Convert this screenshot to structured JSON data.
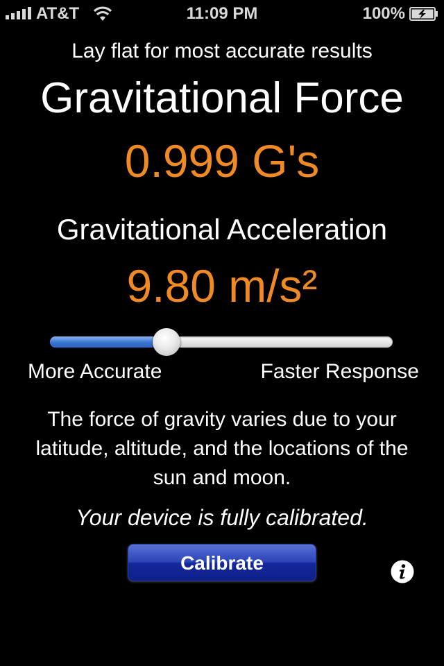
{
  "status_bar": {
    "carrier": "AT&T",
    "time": "11:09 PM",
    "battery": "100%",
    "icons": [
      "signal-bars-icon",
      "wifi-icon",
      "battery-charging-icon"
    ]
  },
  "hint": "Lay flat for most accurate results",
  "force": {
    "title": "Gravitational Force",
    "value": "0.999 G's"
  },
  "acceleration": {
    "title": "Gravitational Acceleration",
    "value": "9.80 m/s²"
  },
  "slider": {
    "position": 0.34,
    "left_label": "More Accurate",
    "right_label": "Faster Response"
  },
  "info_text": "The force of gravity varies due to your latitude, altitude, and the locations of the sun and moon.",
  "calibration_status": "Your device is fully calibrated.",
  "calibrate_button": "Calibrate",
  "info_button_icon": "info-icon",
  "colors": {
    "accent": "#f08a24",
    "background": "#000000",
    "button": "#1e34a8",
    "slider_fill": "#3a74d3"
  }
}
